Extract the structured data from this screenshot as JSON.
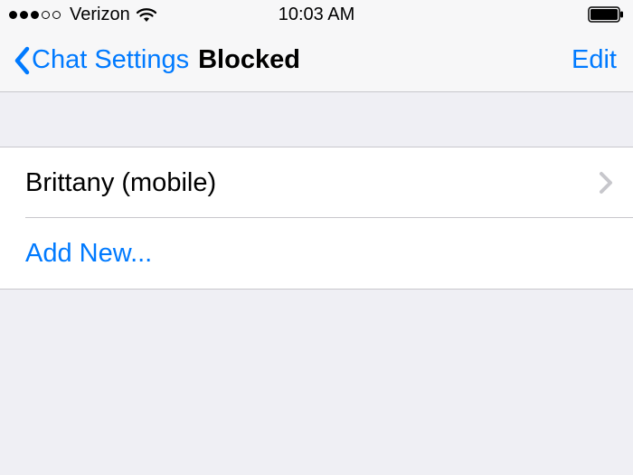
{
  "statusBar": {
    "carrier": "Verizon",
    "time": "10:03 AM"
  },
  "nav": {
    "back": "Chat Settings",
    "title": "Blocked",
    "edit": "Edit"
  },
  "list": {
    "items": [
      {
        "label": "Brittany (mobile)"
      }
    ],
    "addNew": "Add New..."
  }
}
